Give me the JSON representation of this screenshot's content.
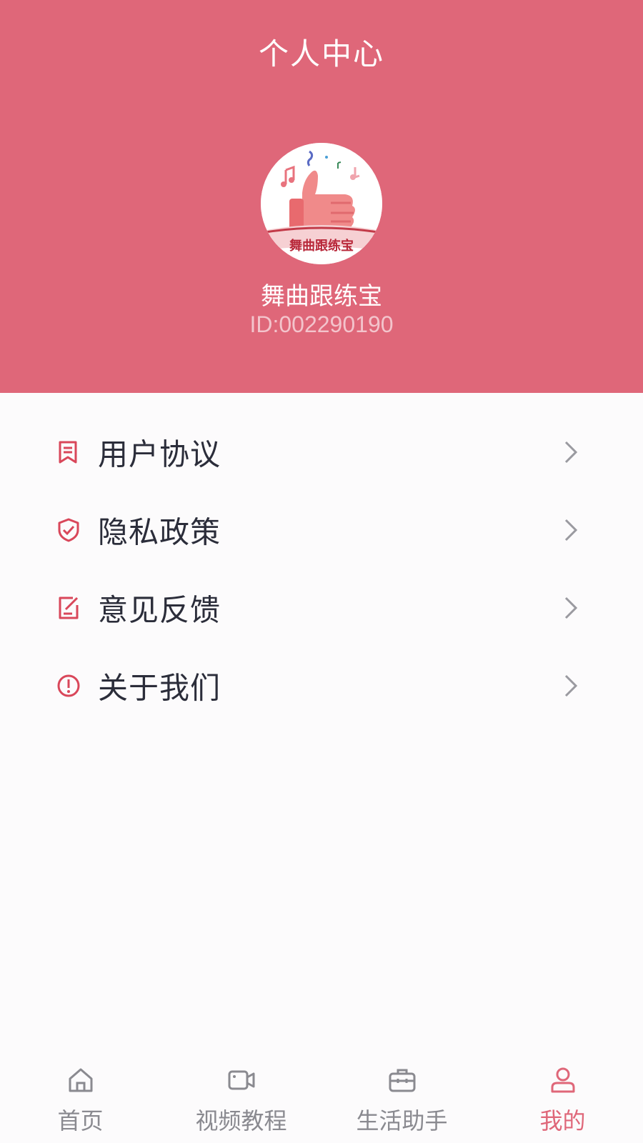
{
  "header": {
    "title": "个人中心",
    "avatar_icon": "thumbs-up-logo",
    "avatar_text": "舞曲跟练宝",
    "app_name": "舞曲跟练宝",
    "user_id": "ID:002290190",
    "background_color": "#df6779"
  },
  "menu": {
    "items": [
      {
        "label": "用户协议",
        "icon": "document-icon"
      },
      {
        "label": "隐私政策",
        "icon": "shield-icon"
      },
      {
        "label": "意见反馈",
        "icon": "feedback-icon"
      },
      {
        "label": "关于我们",
        "icon": "info-icon"
      }
    ]
  },
  "tabbar": {
    "tabs": [
      {
        "label": "首页",
        "icon": "home-icon",
        "active": false
      },
      {
        "label": "视频教程",
        "icon": "video-icon",
        "active": false
      },
      {
        "label": "生活助手",
        "icon": "briefcase-icon",
        "active": false
      },
      {
        "label": "我的",
        "icon": "user-icon",
        "active": true
      }
    ],
    "active_color": "#df6779",
    "inactive_color": "#8a8a90"
  }
}
